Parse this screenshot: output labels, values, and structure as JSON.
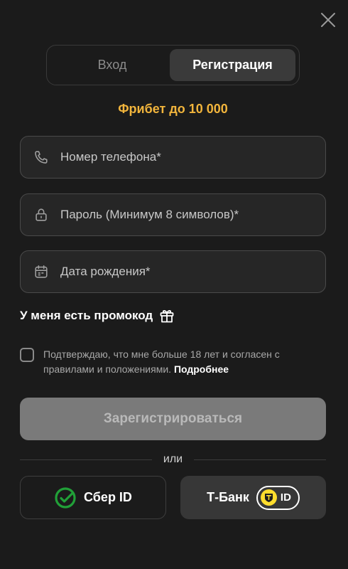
{
  "tabs": {
    "login": "Вход",
    "register": "Регистрация",
    "active": "register"
  },
  "promo_text": "Фрибет до 10 000",
  "fields": {
    "phone": {
      "placeholder": "Номер телефона*",
      "value": ""
    },
    "password": {
      "placeholder": "Пароль (Минимум 8 символов)*",
      "value": ""
    },
    "birthdate": {
      "placeholder": "Дата рождения*",
      "value": ""
    }
  },
  "promocode_label": "У меня есть промокод",
  "agreement": {
    "checked": false,
    "text": "Подтверждаю, что мне больше 18 лет и согласен с правилами и положениями.",
    "more_link": "Подробнее"
  },
  "submit_label": "Зарегистрироваться",
  "divider_text": "или",
  "social": {
    "sber_label": "Сбер ID",
    "tbank_label": "Т-Банк",
    "tbank_id_label": "ID"
  },
  "colors": {
    "background": "#1b1b1b",
    "accent_promo": "#f2b53c",
    "sber_green": "#21a038",
    "tbank_yellow": "#ffdd2d",
    "submit_disabled": "#7a7a7a"
  },
  "icons": {
    "close": "close-icon",
    "phone": "phone-icon",
    "password": "lock-icon",
    "birthdate": "calendar-icon",
    "promocode": "gift-icon",
    "sber": "sber-logo-icon",
    "tbank": "tbank-shield-icon"
  }
}
